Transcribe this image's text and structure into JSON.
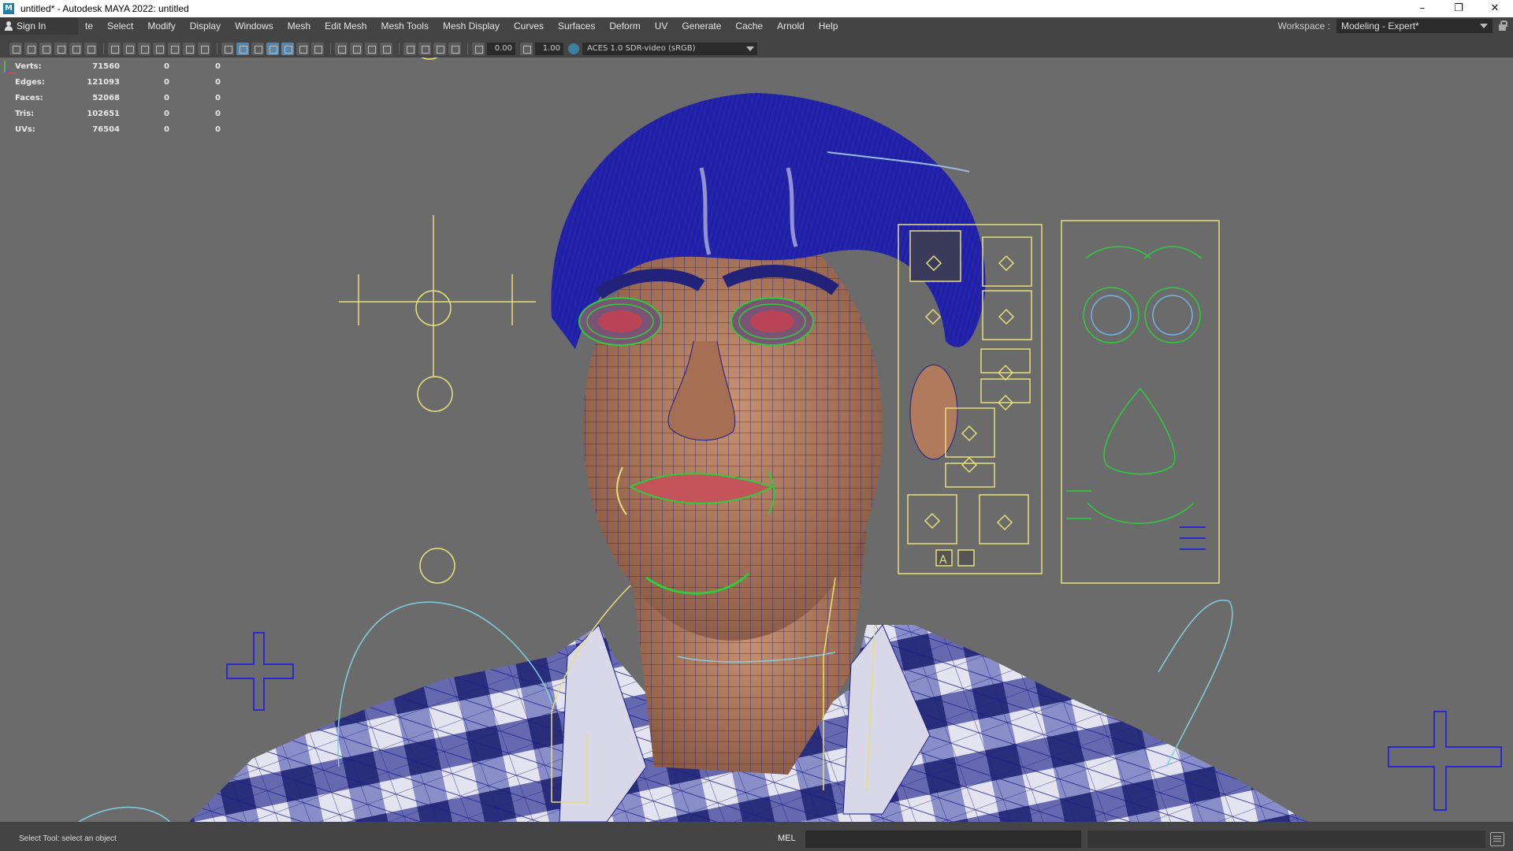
{
  "window": {
    "title": "untitled* - Autodesk MAYA 2022: untitled",
    "app_icon": "M",
    "controls": [
      "minimize-icon",
      "restore-icon",
      "close-icon"
    ]
  },
  "menubar": {
    "sign_in": "Sign In",
    "items": [
      "te",
      "Select",
      "Modify",
      "Display",
      "Windows",
      "Mesh",
      "Edit Mesh",
      "Mesh Tools",
      "Mesh Display",
      "Curves",
      "Surfaces",
      "Deform",
      "UV",
      "Generate",
      "Cache",
      "Arnold",
      "Help"
    ],
    "workspace_label": "Workspace :",
    "workspace_value": "Modeling - Expert*"
  },
  "panel_toolbar": {
    "exposure": "0.00",
    "gamma": "1.00",
    "color_space": "ACES 1.0 SDR-video (sRGB)"
  },
  "hud": {
    "rows": [
      {
        "label": "Verts:",
        "v1": "71560",
        "v2": "0",
        "v3": "0"
      },
      {
        "label": "Edges:",
        "v1": "121093",
        "v2": "0",
        "v3": "0"
      },
      {
        "label": "Faces:",
        "v1": "52068",
        "v2": "0",
        "v3": "0"
      },
      {
        "label": "Tris:",
        "v1": "102651",
        "v2": "0",
        "v3": "0"
      },
      {
        "label": "UVs:",
        "v1": "76504",
        "v2": "0",
        "v3": "0"
      }
    ]
  },
  "viewport": {
    "camera": "persp",
    "background": "#6b6b6b",
    "wire_color": "#1e1e9a",
    "control_color": "#e6e07a",
    "face_panel_label": "A"
  },
  "statusbar": {
    "help_line": "Select Tool: select an object",
    "command_language": "MEL"
  }
}
